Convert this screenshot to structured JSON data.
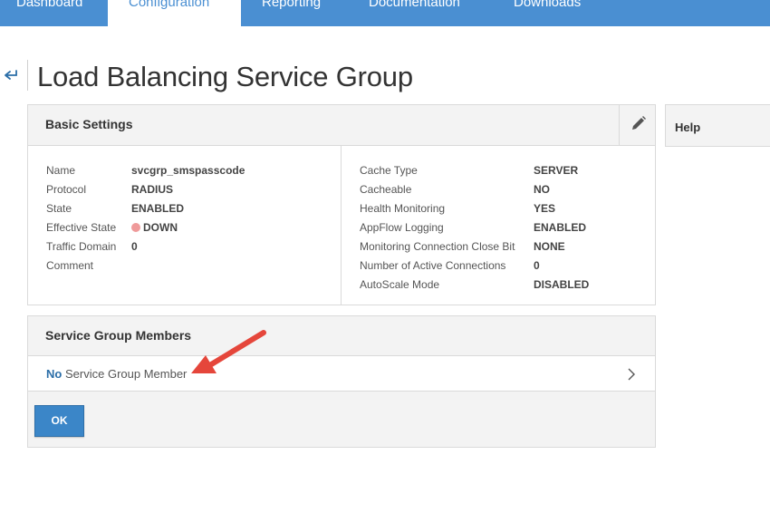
{
  "nav": {
    "tabs": [
      {
        "label": "Dashboard",
        "active": false
      },
      {
        "label": "Configuration",
        "active": true
      },
      {
        "label": "Reporting",
        "active": false
      },
      {
        "label": "Documentation",
        "active": false
      },
      {
        "label": "Downloads",
        "active": false
      }
    ],
    "bar_color": "#4a8fd2"
  },
  "page": {
    "title": "Load Balancing Service Group",
    "back_icon": "back-arrow-icon"
  },
  "basic_settings": {
    "title": "Basic Settings",
    "edit_icon": "pencil-icon",
    "left": [
      {
        "label": "Name",
        "value": "svcgrp_smspasscode"
      },
      {
        "label": "Protocol",
        "value": "RADIUS"
      },
      {
        "label": "State",
        "value": "ENABLED"
      },
      {
        "label": "Effective State",
        "value": "DOWN",
        "status_color": "#ef9a9a"
      },
      {
        "label": "Traffic Domain",
        "value": "0"
      },
      {
        "label": "Comment",
        "value": ""
      }
    ],
    "right": [
      {
        "label": "Cache Type",
        "value": "SERVER"
      },
      {
        "label": "Cacheable",
        "value": "NO"
      },
      {
        "label": "Health Monitoring",
        "value": "YES"
      },
      {
        "label": "AppFlow Logging",
        "value": "ENABLED"
      },
      {
        "label": "Monitoring Connection Close Bit",
        "value": "NONE"
      },
      {
        "label": "Number of Active Connections",
        "value": "0"
      },
      {
        "label": "AutoScale Mode",
        "value": "DISABLED"
      }
    ]
  },
  "help": {
    "title": "Help"
  },
  "members": {
    "title": "Service Group Members",
    "count_label": "No",
    "row_text": "Service Group Member",
    "chevron_icon": "chevron-right-icon"
  },
  "actions": {
    "ok_label": "OK",
    "accent": "#3b86c8"
  },
  "annotation": {
    "arrow_color": "#e5463b"
  }
}
